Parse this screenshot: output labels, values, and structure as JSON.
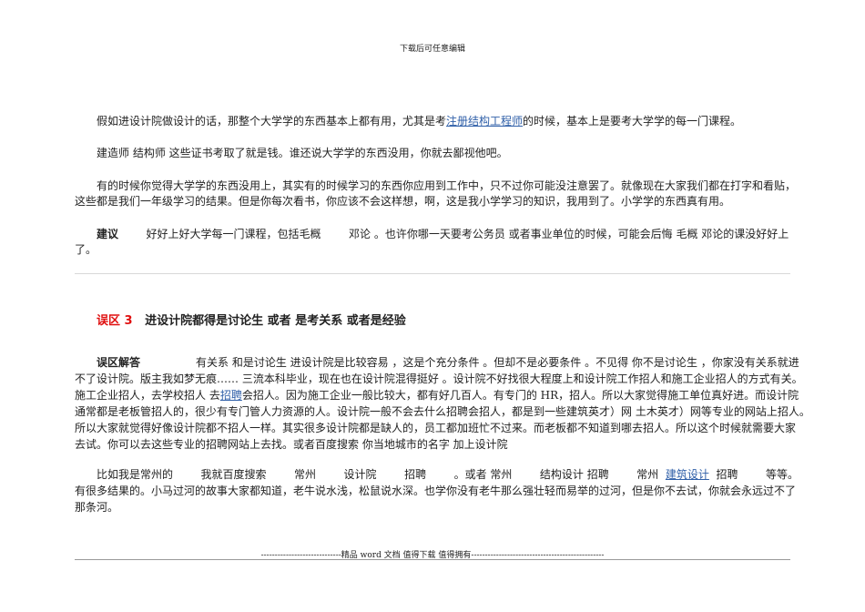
{
  "header": "下载后可任意编辑",
  "p1": {
    "a": "假如进设计院做设计的话，那整个大学学的东西基本上都有用，尤其是考",
    "link": "注册结构工程师",
    "b": "的时候，基本上是要考大学学的每一门课程。"
  },
  "p2": "建造师 结构师 这些证书考取了就是钱。谁还说大学学的东西没用，你就去鄙视他吧。",
  "p3": [
    "有的时候你觉得大学学的东西没用上，其实有的时候学习的东西你应用到工作中，只不过你可能没注意罢了。就像现在大家我们都在打字和看贴，",
    "这些都是我们一年级学习的结果。但是你每次看书，你应该不会这样想，啊，这是我小学学习的知识，我用到了。小学学的东西真有用。"
  ],
  "p4": {
    "label": "建议",
    "lines": [
      "        好好上好大学每一门课程，包括毛概        邓论 。也许你哪一天要考公务员 或者事业单位的时候，可能会后悔 毛概 邓论的课没好好上",
      "了。"
    ]
  },
  "heading": {
    "num": "误区 3",
    "title": "进设计院都得是讨论生 或者 是考关系 或者是经验"
  },
  "p5": {
    "label": "误区解答",
    "l1": "                有关系 和是讨论生 进设计院是比较容易 ，这是个充分条件 。但却不是必要条件 。不见得 你不是讨论生 ，你家没有关系就进",
    "l2": "不了设计院。版主我如梦无痕…… 三流本科毕业，现在也在设计院混得挺好 。设计院不好找很大程度上和设计院工作招人和施工企业招人的方式有关。",
    "l3a": "施工企业招人，去学校招人 去",
    "l3link": "招聘",
    "l3b": "会招人。因为施工企业一般比较大，都有好几百人。有专门的 HR，招人。所以大家觉得施工单位真好进。而设计院",
    "l4": "通常都是老板管招人的，很少有专门管人力资源的人。设计院一般不会去什么招聘会招人，都是到一些建筑英才）网 土木英才）网等专业的网站上招人。",
    "l5": "所以大家就觉得好像设计院都不招人一样。其实很多设计院都是缺人的，员工都加班忙不过来。而老板都不知道到哪去招人。所以这个时候就需要大家",
    "l6": "去试。你可以去这些专业的招聘网站上去找。或者百度搜索 你当地城市的名字 加上设计院"
  },
  "p6": {
    "l1a": "比如我是常州的        我就百度搜索        常州        设计院        招聘        。或者 常州        结构设计 招聘        常州  ",
    "l1link": "建筑设计",
    "l1b": "  招聘        等等。",
    "l2": "有很多结果的。小马过河的故事大家都知道，老牛说水浅，松鼠说水深。也学你没有老牛那么强壮轻而易举的过河，但是你不去试，你就会永远过不了",
    "l3": "那条河。"
  },
  "footer": "-----------------------------精品 word 文档 值得下载 值得拥有------------------------------------------------"
}
